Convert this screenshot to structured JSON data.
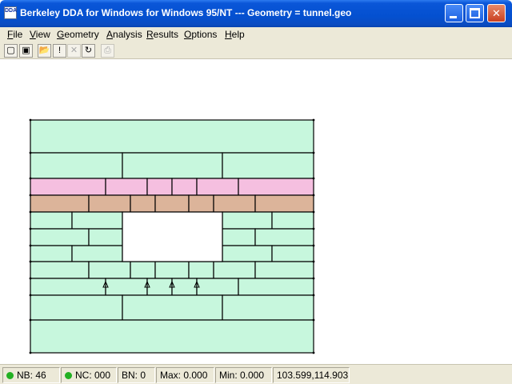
{
  "window": {
    "title": "Berkeley DDA for Windows for Windows 95/NT  ---  Geometry = tunnel.geo",
    "icon_label": "DDA"
  },
  "menu": [
    {
      "label": "File",
      "mnemonic": "F",
      "rest": "ile"
    },
    {
      "label": "View",
      "mnemonic": "V",
      "rest": "iew"
    },
    {
      "label": "Geometry",
      "mnemonic": "G",
      "rest": "eometry"
    },
    {
      "label": "Analysis",
      "mnemonic": "A",
      "rest": "nalysis"
    },
    {
      "label": "Results",
      "mnemonic": "R",
      "rest": "esults"
    },
    {
      "label": "Options",
      "mnemonic": "O",
      "rest": "ptions"
    },
    {
      "label": "Help",
      "mnemonic": "H",
      "rest": "elp"
    }
  ],
  "toolbar": [
    {
      "name": "new-geometry",
      "glyph": "▢"
    },
    {
      "name": "new-analysis",
      "glyph": "▣"
    },
    {
      "name": "open",
      "glyph": "📂"
    },
    {
      "name": "run",
      "glyph": "!"
    },
    {
      "name": "cancel",
      "glyph": "✕"
    },
    {
      "name": "refresh",
      "glyph": "↻"
    },
    {
      "name": "print",
      "glyph": "⎙"
    }
  ],
  "colors": {
    "block_green": "#c7f7dd",
    "block_pink": "#f5bfe0",
    "block_tan": "#dcb49a",
    "joint": "#000000"
  },
  "status": {
    "nb": "NB: 46",
    "nc": "NC: 000",
    "bn": "BN: 0",
    "max": "Max: 0.000",
    "min": "Min: 0.000",
    "coords": "103.599,114.903"
  }
}
